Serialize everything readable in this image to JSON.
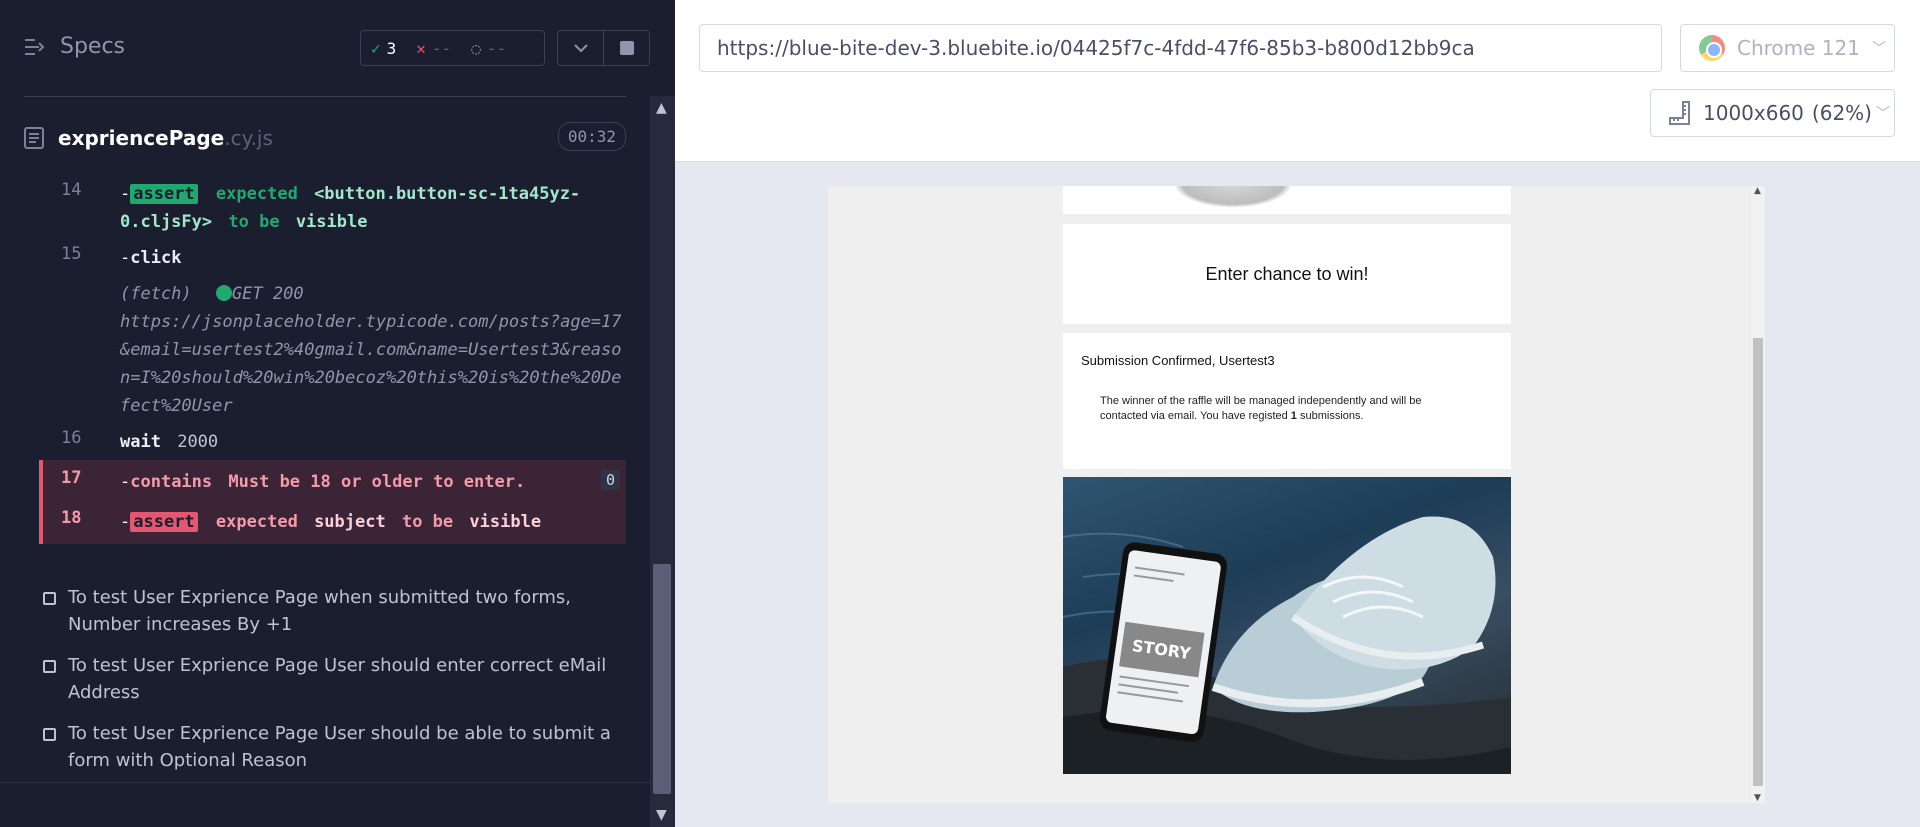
{
  "specs": {
    "title": "Specs",
    "stats": {
      "passed": "3",
      "failed": "--",
      "pending": "--"
    },
    "file": {
      "name": "expriencePage",
      "ext": ".cy.js",
      "duration": "00:32"
    }
  },
  "commands": [
    {
      "num": "14",
      "dash": "-",
      "name": "assert",
      "parts": [
        "expected",
        "<button.button-sc-1ta45yz-0.cljsFy>",
        "to be",
        "visible"
      ]
    },
    {
      "num": "15",
      "dash": "-",
      "name": "click"
    },
    {
      "num": "",
      "fetch_label": "(fetch)",
      "fetch_status": "GET 200",
      "fetch_url": "https://jsonplaceholder.typicode.com/posts?age=17&email=usertest2%40gmail.com&name=Usertest3&reason=I%20should%20win%20becoz%20this%20is%20the%20Defect%20User"
    },
    {
      "num": "16",
      "name": "wait",
      "value": "2000"
    },
    {
      "num": "17",
      "dash": "-",
      "name": "contains",
      "value": "Must be 18 or older to enter.",
      "badge": "0"
    },
    {
      "num": "18",
      "dash": "-",
      "name": "assert",
      "parts": [
        "expected",
        "subject",
        "to be",
        "visible"
      ]
    }
  ],
  "tests": [
    "To test User Exprience Page when submitted two forms, Number increases By +1",
    "To test User Exprience Page User should enter correct eMail Address",
    "To test User Exprience Page User should be able to submit a form with Optional Reason"
  ],
  "browser": {
    "url": "https://blue-bite-dev-3.bluebite.io/04425f7c-4fdd-47f6-85b3-b800d12bb9ca",
    "name": "Chrome 121",
    "viewport": "1000x660",
    "zoom": "(62%)"
  },
  "aut": {
    "enter_button": "Enter chance to win!",
    "confirm_title": "Submission Confirmed, Usertest3",
    "confirm_text_before": "The winner of the raffle will be managed independently and will be contacted via email. You have registed ",
    "confirm_count": "1",
    "confirm_text_after": " submissions."
  },
  "colors": {
    "pass": "#1fa971",
    "fail": "#e45770",
    "panel": "#1b1e2e"
  }
}
